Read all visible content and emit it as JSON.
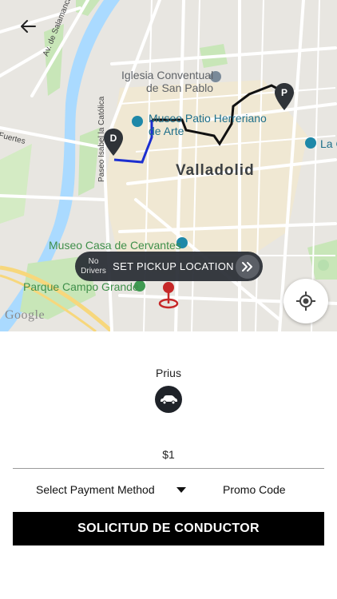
{
  "colors": {
    "accent": "#000000",
    "route_black": "#111111",
    "route_blue": "#1c2fd0",
    "pickup_pin": "#c62828",
    "bar_bg": "#282c34"
  },
  "map": {
    "labels": {
      "street_salamanca": "Av. de Salamanca",
      "street_fuertes": "Fuertes",
      "street_paseo": "Paseo Isabel la Católica",
      "iglesia_line1": "Iglesia Conventual",
      "iglesia_line2": "de San Pablo",
      "museo_patio_line1": "Museo Patio Herreriano",
      "museo_patio_line2": "de Arte",
      "city": "Valladolid",
      "la_c": "La C",
      "museo_cervantes": "Museo Casa de Cervantes",
      "parque": "Parque Campo Grande",
      "google": "Google"
    },
    "pins": {
      "destination": "D",
      "pickup": "P"
    }
  },
  "pickup_bar": {
    "no_drivers": "No Drivers",
    "set_pickup": "SET PICKUP LOCATION"
  },
  "icons": {
    "back": "back-arrow-icon",
    "chevron": "double-chevron-right-icon",
    "locate": "my-location-icon",
    "car": "car-icon"
  },
  "vehicle": {
    "name": "Prius"
  },
  "fare": {
    "amount": "$1"
  },
  "payment": {
    "label": "Select Payment Method"
  },
  "promo": {
    "label": "Promo Code"
  },
  "request_button": {
    "label": "SOLICITUD DE CONDUCTOR"
  }
}
